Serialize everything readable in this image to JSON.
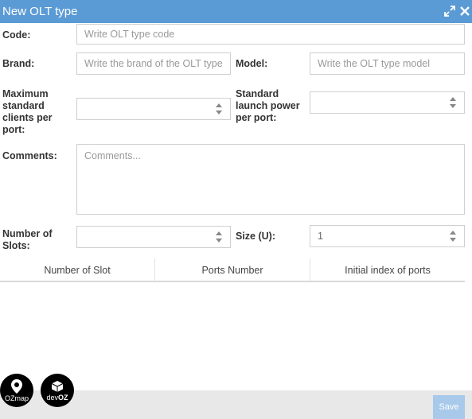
{
  "dialog": {
    "title": "New OLT type",
    "maximize_icon": "expand-icon",
    "close_icon": "close-icon"
  },
  "form": {
    "code_label": "Code:",
    "code_placeholder": "Write OLT type code",
    "brand_label": "Brand:",
    "brand_placeholder": "Write the brand of the OLT type",
    "model_label": "Model:",
    "model_placeholder": "Write the OLT type model",
    "max_clients_label_lines": [
      "Maximum",
      "standard",
      "clients per",
      "port:"
    ],
    "launch_power_label_lines": [
      "Standard",
      "launch power",
      "per port:"
    ],
    "max_clients_value": "",
    "launch_power_value": "",
    "comments_label": "Comments:",
    "comments_placeholder": "Comments...",
    "slots_label_lines": [
      "Number of",
      "Slots:"
    ],
    "slots_value": "",
    "size_label": "Size (U):",
    "size_value": "1"
  },
  "table": {
    "columns": [
      "Number of Slot",
      "Ports Number",
      "Initial index of ports"
    ]
  },
  "footer": {
    "save_label": "Save"
  },
  "logos": {
    "ozmap": "OZmap",
    "devoz_prefix": "dev",
    "devoz_suffix": "OZ"
  },
  "colors": {
    "titlebar": "#5b9bd5",
    "save_button": "#a8c9ea",
    "footer": "#e8e8e8"
  }
}
